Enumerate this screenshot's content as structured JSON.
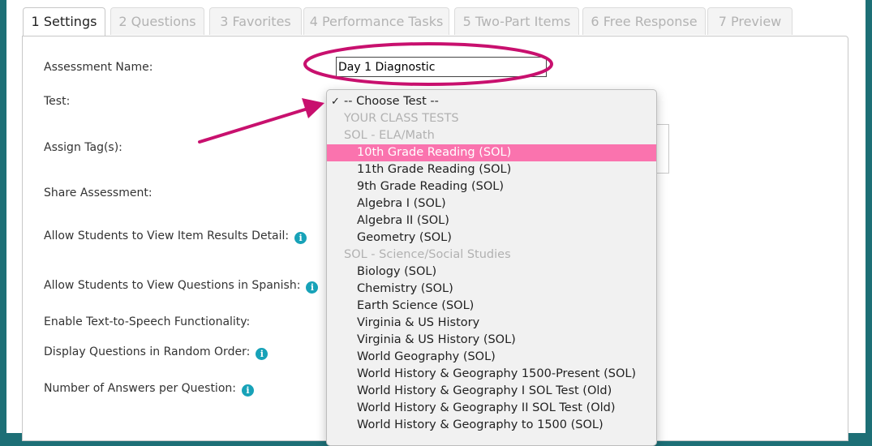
{
  "tabs": [
    {
      "label": "1 Settings",
      "active": true
    },
    {
      "label": "2 Questions",
      "active": false
    },
    {
      "label": "3 Favorites",
      "active": false
    },
    {
      "label": "4 Performance Tasks",
      "active": false
    },
    {
      "label": "5 Two-Part Items",
      "active": false
    },
    {
      "label": "6 Free Response",
      "active": false
    },
    {
      "label": "7 Preview",
      "active": false
    }
  ],
  "form": {
    "assessment_name_label": "Assessment Name:",
    "assessment_name_value": "Day 1 Diagnostic",
    "test_label": "Test:",
    "assign_tags_label": "Assign Tag(s):",
    "share_label": "Share Assessment:",
    "allow_item_results_label": "Allow Students to View Item Results Detail:",
    "allow_spanish_label": "Allow Students to View Questions in Spanish:",
    "tts_label": "Enable Text-to-Speech Functionality:",
    "random_order_label": "Display Questions in Random Order:",
    "answers_per_question_label": "Number of Answers per Question:",
    "info_icon_glyph": "i"
  },
  "dropdown": {
    "checkmark": "✓",
    "placeholder": "-- Choose Test --",
    "group_class_tests": "YOUR CLASS TESTS",
    "group_ela_math": "SOL - ELA/Math",
    "ela_math_items": [
      "10th Grade Reading (SOL)",
      "11th Grade Reading (SOL)",
      "9th Grade Reading (SOL)",
      "Algebra I (SOL)",
      "Algebra II (SOL)",
      "Geometry (SOL)"
    ],
    "group_science_social": "SOL - Science/Social Studies",
    "science_social_items": [
      "Biology (SOL)",
      "Chemistry (SOL)",
      "Earth Science (SOL)",
      "Virginia & US History",
      "Virginia & US History (SOL)",
      "World Geography (SOL)",
      "World History & Geography 1500-Present (SOL)",
      "World History & Geography I SOL Test (Old)",
      "World History & Geography II SOL Test (Old)",
      "World History & Geography to 1500 (SOL)"
    ],
    "selected_item": "10th Grade Reading (SOL)"
  },
  "colors": {
    "annotation": "#c8106e",
    "highlight": "#fa73ae",
    "info_icon": "#17a2b8",
    "frame": "#1d6f76"
  },
  "icons": {
    "info": "info-icon",
    "check": "checkmark-icon",
    "arrow": "annotation-arrow",
    "ellipse": "annotation-ellipse"
  }
}
